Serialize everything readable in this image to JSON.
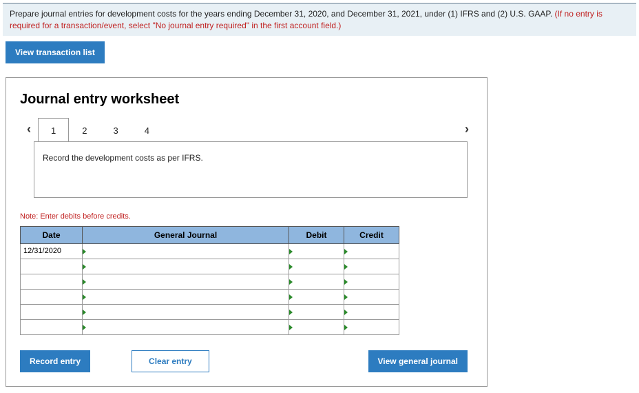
{
  "instructions": {
    "main": "Prepare journal entries for development costs for the years ending December 31, 2020, and December 31, 2021, under (1) IFRS and (2) U.S. GAAP. ",
    "hint": "(If no entry is required for a transaction/event, select \"No journal entry required\" in the first account field.)"
  },
  "buttons": {
    "view_transaction_list": "View transaction list",
    "record_entry": "Record entry",
    "clear_entry": "Clear entry",
    "view_general_journal": "View general journal"
  },
  "worksheet": {
    "title": "Journal entry worksheet",
    "tabs": [
      "1",
      "2",
      "3",
      "4"
    ],
    "active_tab": 0,
    "prompt": "Record the development costs as per IFRS.",
    "note": "Note: Enter debits before credits."
  },
  "table": {
    "headers": {
      "date": "Date",
      "general_journal": "General Journal",
      "debit": "Debit",
      "credit": "Credit"
    },
    "rows": [
      {
        "date": "12/31/2020",
        "gj": "",
        "debit": "",
        "credit": ""
      },
      {
        "date": "",
        "gj": "",
        "debit": "",
        "credit": ""
      },
      {
        "date": "",
        "gj": "",
        "debit": "",
        "credit": ""
      },
      {
        "date": "",
        "gj": "",
        "debit": "",
        "credit": ""
      },
      {
        "date": "",
        "gj": "",
        "debit": "",
        "credit": ""
      },
      {
        "date": "",
        "gj": "",
        "debit": "",
        "credit": ""
      }
    ]
  }
}
